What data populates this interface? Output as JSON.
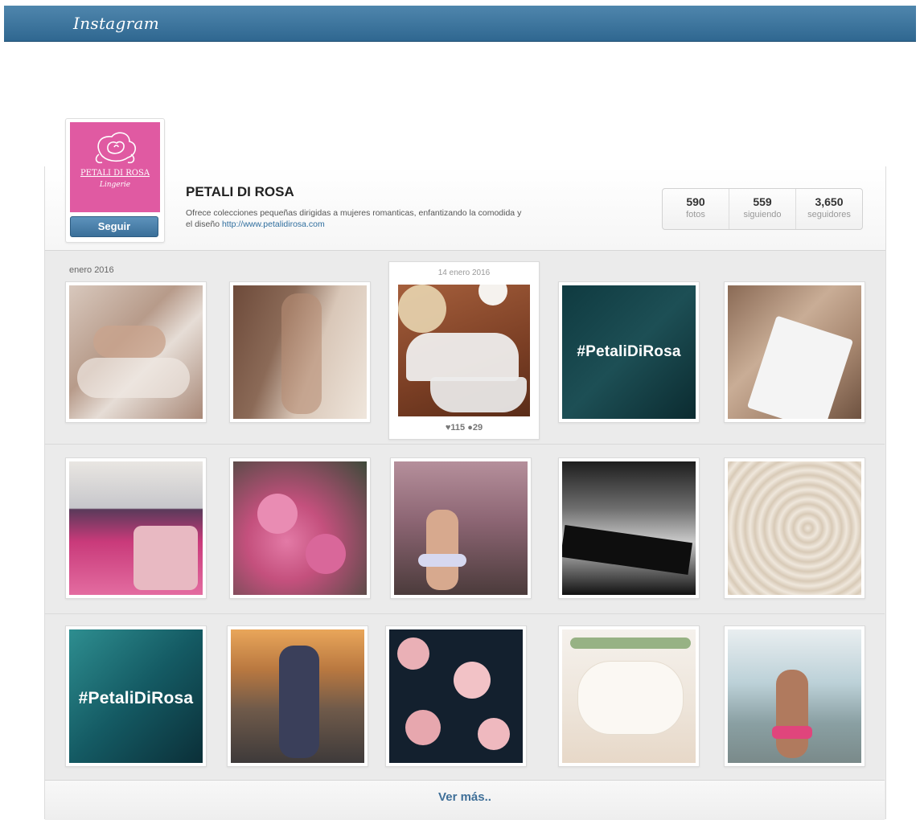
{
  "app": {
    "title": "Instagram"
  },
  "profile": {
    "name": "PETALI DI ROSA",
    "bio": "Ofrece colecciones pequeñas dirigidas a mujeres romanticas, enfantizando la comodida y el diseño",
    "website": "http://www.petalidirosa.com",
    "follow_label": "Seguir",
    "avatar_brand": "PETALI DI ROSA",
    "avatar_sub": "Lingerie"
  },
  "stats": [
    {
      "value": "590",
      "label": "fotos"
    },
    {
      "value": "559",
      "label": "siguiendo"
    },
    {
      "value": "3,650",
      "label": "seguidores"
    }
  ],
  "feed": {
    "month_label": "enero 2016",
    "featured": {
      "date": "14 enero 2016",
      "likes": "115",
      "comments": "29"
    },
    "hashtag": "#PetaliDiRosa",
    "more_label": "Ver más.."
  },
  "colors": {
    "topbar": "#3a729b",
    "avatar_pink": "#e05aa2",
    "link": "#2f6e9e"
  }
}
